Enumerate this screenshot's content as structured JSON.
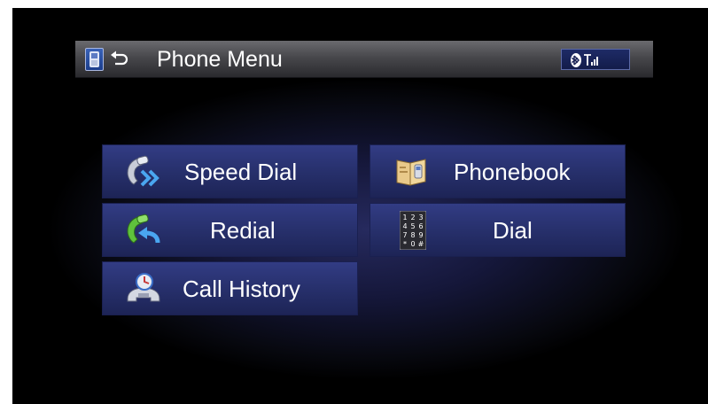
{
  "header": {
    "title": "Phone Menu",
    "phone_icon": "phone-icon",
    "back_icon": "back-arrow-icon",
    "status_icons": [
      "bluetooth-icon",
      "signal-strength-icon"
    ]
  },
  "menu": {
    "items": [
      {
        "label": "Speed Dial",
        "icon": "speed-dial-icon"
      },
      {
        "label": "Phonebook",
        "icon": "phonebook-icon"
      },
      {
        "label": "Redial",
        "icon": "redial-icon"
      },
      {
        "label": "Dial",
        "icon": "keypad-icon"
      },
      {
        "label": "Call History",
        "icon": "call-history-icon"
      }
    ]
  },
  "keypad_digits": [
    "1",
    "2",
    "3",
    "4",
    "5",
    "6",
    "7",
    "8",
    "9",
    "*",
    "0",
    "#"
  ],
  "colors": {
    "button_top": "#323c84",
    "button_bottom": "#1d2456",
    "header_top": "#6a6a6e",
    "header_bottom": "#2a2a2e",
    "accent_green": "#5bbf3a",
    "accent_blue": "#4a9fe8"
  }
}
